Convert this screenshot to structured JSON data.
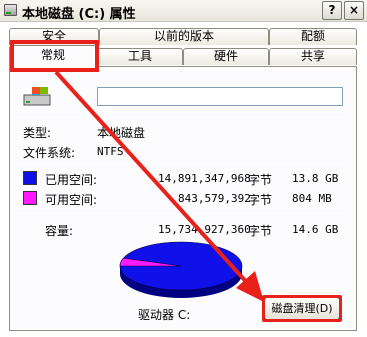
{
  "window": {
    "title": "本地磁盘 (C:) 属性",
    "help_label": "?",
    "close_label": "×"
  },
  "tabs": {
    "row1": [
      {
        "label": "安全"
      },
      {
        "label": "以前的版本"
      },
      {
        "label": "配额"
      }
    ],
    "row2": [
      {
        "label": "常规",
        "active": true
      },
      {
        "label": "工具"
      },
      {
        "label": "硬件"
      },
      {
        "label": "共享"
      }
    ]
  },
  "general": {
    "drive_name_value": "",
    "type_label": "类型:",
    "type_value": "本地磁盘",
    "fs_label": "文件系统:",
    "fs_value": "NTFS",
    "used": {
      "label": "已用空间:",
      "bytes": "14,891,347,968",
      "unit": "字节",
      "size": "13.8 GB",
      "color": "#1010e8"
    },
    "free": {
      "label": "可用空间:",
      "bytes": "843,579,392",
      "unit": "字节",
      "size": "804 MB",
      "color": "#ff1aff"
    },
    "capacity": {
      "label": "容量:",
      "bytes": "15,734,927,360",
      "unit": "字节",
      "size": "14.6 GB"
    },
    "drive_label": "驱动器 C:",
    "cleanup_button": "磁盘清理(D)",
    "free_fraction": 0.0536
  },
  "annotation": {
    "color": "#e8211b"
  }
}
